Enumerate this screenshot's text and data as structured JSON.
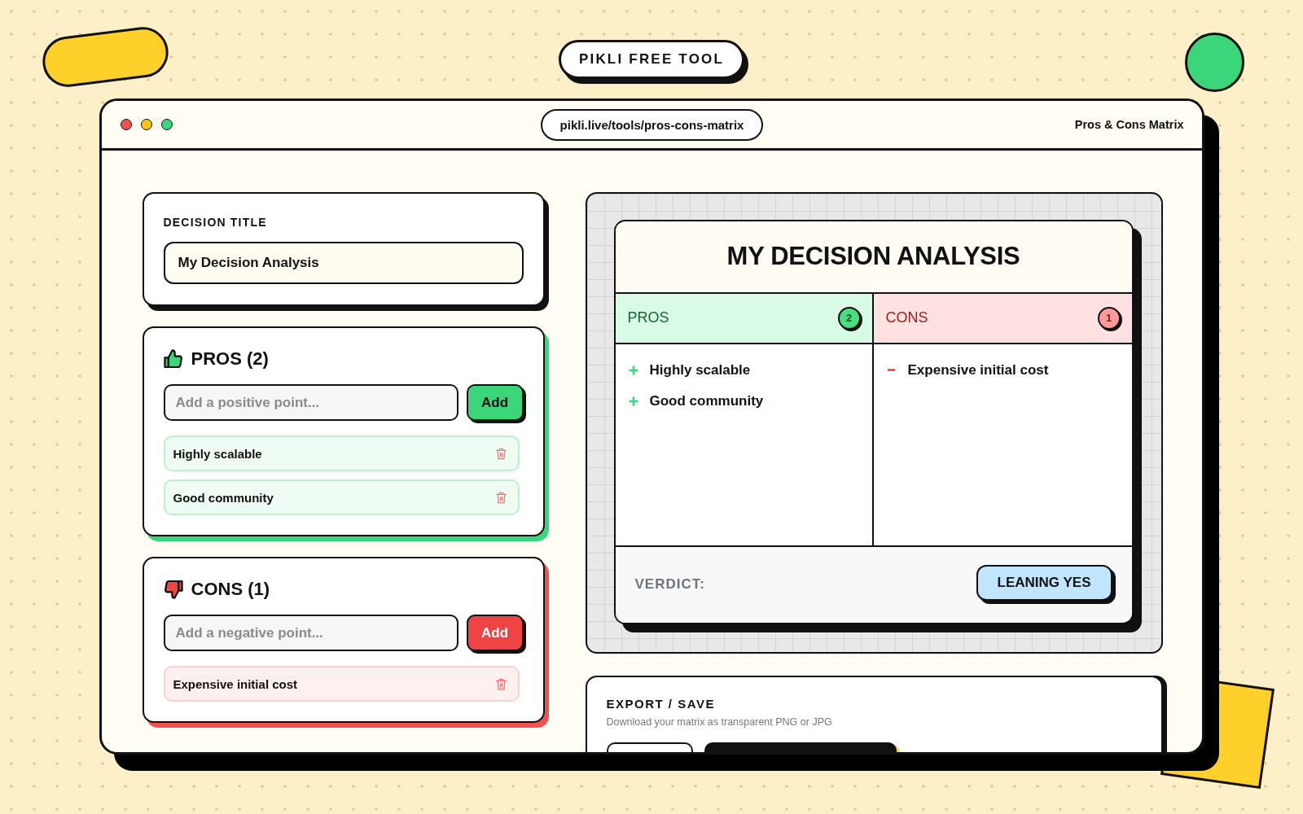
{
  "badge": {
    "label": "PIKLI FREE TOOL"
  },
  "window": {
    "url": "pikli.live/tools/pros-cons-matrix",
    "title": "Pros & Cons Matrix"
  },
  "decision": {
    "label": "DECISION TITLE",
    "value": "My Decision Analysis"
  },
  "lists": [
    {
      "kind": "pros",
      "heading": "PROS (2)",
      "placeholder": "Add a positive point...",
      "button": "Add",
      "items": [
        "Highly scalable",
        "Good community"
      ]
    },
    {
      "kind": "cons",
      "heading": "CONS (1)",
      "placeholder": "Add a negative point...",
      "button": "Add",
      "items": [
        "Expensive initial cost"
      ]
    }
  ],
  "matrix": {
    "title": "MY DECISION ANALYSIS",
    "columns": [
      {
        "kind": "pros",
        "heading": "PROS",
        "count": "2",
        "items": [
          "Highly scalable",
          "Good community"
        ]
      },
      {
        "kind": "cons",
        "heading": "CONS",
        "count": "1",
        "items": [
          "Expensive initial cost"
        ]
      }
    ],
    "verdict": {
      "label": "VERDICT:",
      "value": "LEANING YES"
    }
  },
  "export": {
    "title": "EXPORT / SAVE",
    "description": "Download your matrix as transparent PNG or JPG"
  }
}
